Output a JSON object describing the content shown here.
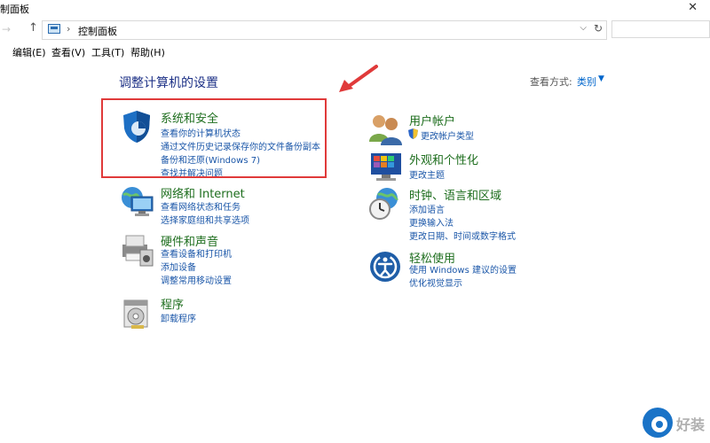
{
  "window": {
    "title": "制面板",
    "close_glyph": "✕"
  },
  "nav": {
    "back_glyph": "→",
    "up_glyph": "↑",
    "breadcrumb_sep": "›",
    "breadcrumb": "控制面板",
    "dropdown_glyph": "⌵",
    "refresh_glyph": "↻",
    "search_placeholder": ""
  },
  "menu": {
    "items": [
      "编辑(E)",
      "查看(V)",
      "工具(T)",
      "帮助(H)"
    ]
  },
  "page": {
    "title": "调整计算机的设置",
    "view_by_label": "查看方式:",
    "view_by_value": "类别",
    "view_by_caret": "▼"
  },
  "categories": {
    "system_security": {
      "title": "系统和安全",
      "links": [
        "查看你的计算机状态",
        "通过文件历史记录保存你的文件备份副本",
        "备份和还原(Windows 7)",
        "查找并解决问题"
      ]
    },
    "network": {
      "title": "网络和 Internet",
      "links": [
        "查看网络状态和任务",
        "选择家庭组和共享选项"
      ]
    },
    "hardware": {
      "title": "硬件和声音",
      "links": [
        "查看设备和打印机",
        "添加设备",
        "调整常用移动设置"
      ]
    },
    "programs": {
      "title": "程序",
      "links": [
        "卸载程序"
      ]
    },
    "user_accounts": {
      "title": "用户帐户",
      "links": [
        "更改帐户类型"
      ]
    },
    "appearance": {
      "title": "外观和个性化",
      "links": [
        "更改主题"
      ]
    },
    "clock_region": {
      "title": "时钟、语言和区域",
      "links": [
        "添加语言",
        "更换输入法",
        "更改日期、时间或数字格式"
      ]
    },
    "ease_access": {
      "title": "轻松使用",
      "links": [
        "使用 Windows 建议的设置",
        "优化视觉显示"
      ]
    }
  },
  "watermark": {
    "text": "好装"
  },
  "colors": {
    "highlight": "#e03a3a",
    "link": "#1a56a8",
    "title_green": "#1e6e1e",
    "accent": "#1a73c7"
  }
}
